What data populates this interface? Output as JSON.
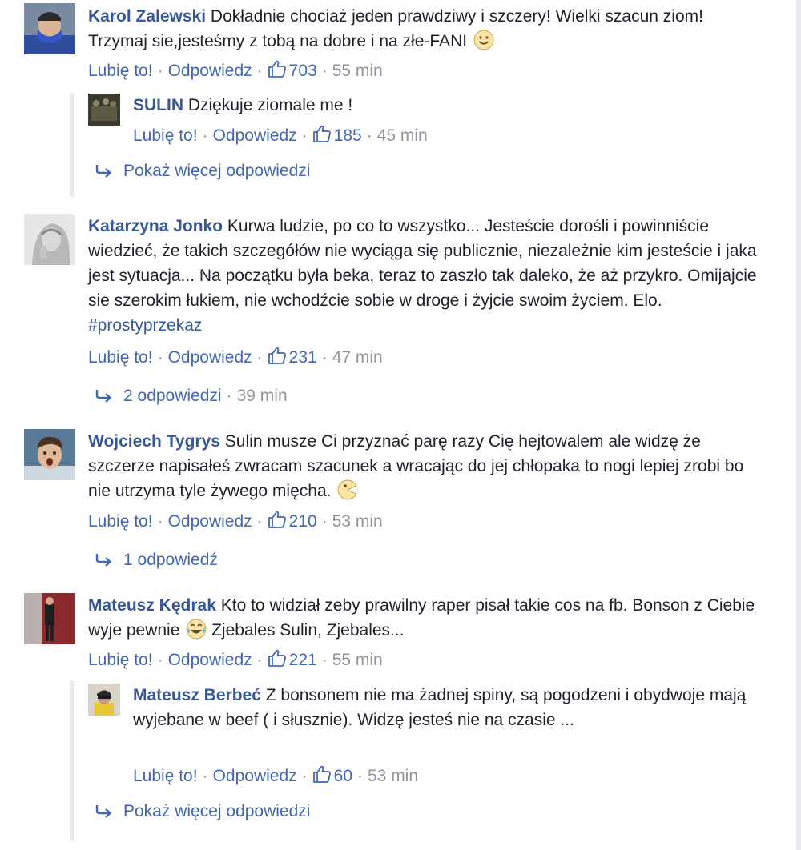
{
  "comments": [
    {
      "author": "Karol Zalewski",
      "text": "Dokładnie chociaż jeden prawdziwy i szczery! Wielki szacun ziom! Trzymaj sie,jesteśmy z tobą na dobre i na złe-FANI",
      "emoji": "smile-emoji",
      "like_label": "Lubię to!",
      "reply_label": "Odpowiedz",
      "likes": "703",
      "time": "55 min",
      "replies": [
        {
          "author": "SULIN",
          "text": "Dziękuje ziomale me !",
          "like_label": "Lubię to!",
          "reply_label": "Odpowiedz",
          "likes": "185",
          "time": "45 min"
        }
      ],
      "more_label": "Pokaż więcej odpowiedzi"
    },
    {
      "author": "Katarzyna Jonko",
      "text": "Kurwa ludzie, po co to wszystko... Jesteście dorośli i powinniście wiedzieć, że takich szczegółów nie wyciąga się publicznie, niezależnie kim jesteście i jaka jest sytuacja... Na początku była beka, teraz to zaszło tak daleko, że aż przykro. Omijajcie sie szerokim łukiem, nie wchodźcie sobie w droge i żyjcie swoim życiem. Elo.",
      "hashtag": "#prostyprzekaz",
      "like_label": "Lubię to!",
      "reply_label": "Odpowiedz",
      "likes": "231",
      "time": "47 min",
      "replies_label": "2 odpowiedzi",
      "replies_time": "39 min"
    },
    {
      "author": "Wojciech Tygrys",
      "text": "Sulin musze Ci przyznać parę razy Cię hejtowalem ale widzę że szczerze napisałeś zwracam szacunek a wracając do jej chłopaka to nogi lepiej zrobi bo nie utrzyma tyle żywego mięcha.",
      "emoji": "pacman-emoji",
      "like_label": "Lubię to!",
      "reply_label": "Odpowiedz",
      "likes": "210",
      "time": "53 min",
      "replies_label": "1 odpowiedź"
    },
    {
      "author": "Mateusz Kędrak",
      "text_before": "Kto to widział zeby prawilny raper pisał takie cos na fb. Bonson z Ciebie wyje pewnie",
      "emoji": "tears-of-joy-emoji",
      "text_after": "Zjebales Sulin, Zjebales...",
      "like_label": "Lubię to!",
      "reply_label": "Odpowiedz",
      "likes": "221",
      "time": "55 min",
      "replies": [
        {
          "author": "Mateusz Berbeć",
          "text": "Z bonsonem nie ma żadnej spiny, są pogodzeni i obydwoje mają wyjebane w beef ( i słusznie). Widzę jesteś nie na czasie ...",
          "like_label": "Lubię to!",
          "reply_label": "Odpowiedz",
          "likes": "60",
          "time": "53 min"
        }
      ],
      "more_label": "Pokaż więcej odpowiedzi"
    }
  ],
  "colors": {
    "link": "#4267b2",
    "author": "#365899",
    "meta_gray": "#90949c",
    "text": "#1d2129",
    "thread_line": "#e9ebee"
  }
}
